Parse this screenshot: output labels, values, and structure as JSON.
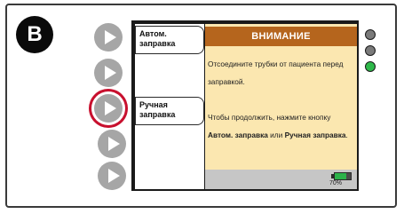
{
  "badge": {
    "label": "B"
  },
  "softkeys": {
    "auto_prime": "Автом. заправка",
    "manual_prime": "Ручная заправка"
  },
  "message": {
    "title": "ВНИМАНИЕ",
    "line1": "Отсоедините трубки от пациента перед заправкой.",
    "line2_prefix": "Чтобы продолжить, нажмите кнопку ",
    "line2_bold1": "Автом. заправка",
    "line2_mid": " или ",
    "line2_bold2": "Ручная заправка",
    "line2_suffix": "."
  },
  "battery": {
    "level": 0.7,
    "text": "70%"
  },
  "indicator_lights": [
    {
      "state": "off",
      "color": "#7a7a7a"
    },
    {
      "state": "off",
      "color": "#7a7a7a"
    },
    {
      "state": "on",
      "color": "#2eb84a"
    }
  ],
  "colors": {
    "title_bar": "#b5651d",
    "message_bg": "#fbe7b0",
    "highlight_ring": "#c8102e",
    "hard_button": "#a6a6a6"
  },
  "hard_buttons": [
    {
      "icon": "play-icon",
      "highlighted": false
    },
    {
      "icon": "play-icon",
      "highlighted": false
    },
    {
      "icon": "play-icon",
      "highlighted": true
    },
    {
      "icon": "play-icon",
      "highlighted": false
    },
    {
      "icon": "play-icon",
      "highlighted": false
    }
  ]
}
